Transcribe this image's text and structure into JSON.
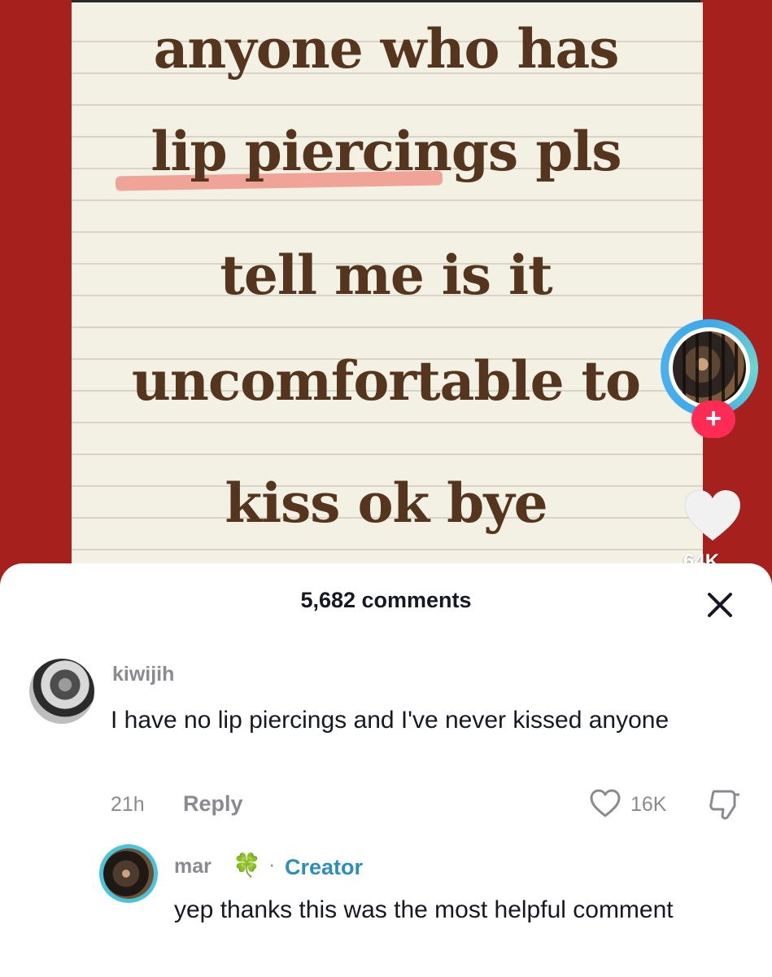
{
  "video": {
    "note_lines": [
      "anyone who has",
      "lip piercings pls",
      "tell me is it",
      "uncomfortable to",
      "kiss ok bye"
    ],
    "follow_symbol": "+",
    "like_count": "64K",
    "colors": {
      "background": "#a6201e",
      "paper": "#f3f1e4",
      "text": "#55351d",
      "highlight": "#ef9b8f",
      "follow_button": "#fe2c55"
    }
  },
  "comments_sheet": {
    "title": "5,682 comments",
    "close_icon": "close-icon",
    "comment": {
      "username": "kiwijih",
      "text": "I have no lip piercings and I've never kissed anyone",
      "time": "21h",
      "reply_label": "Reply",
      "likes": "16K"
    },
    "reply": {
      "username": "mar",
      "emoji": "🍀",
      "separator": "·",
      "badge": "Creator",
      "text": "yep thanks this was the most helpful comment"
    }
  }
}
